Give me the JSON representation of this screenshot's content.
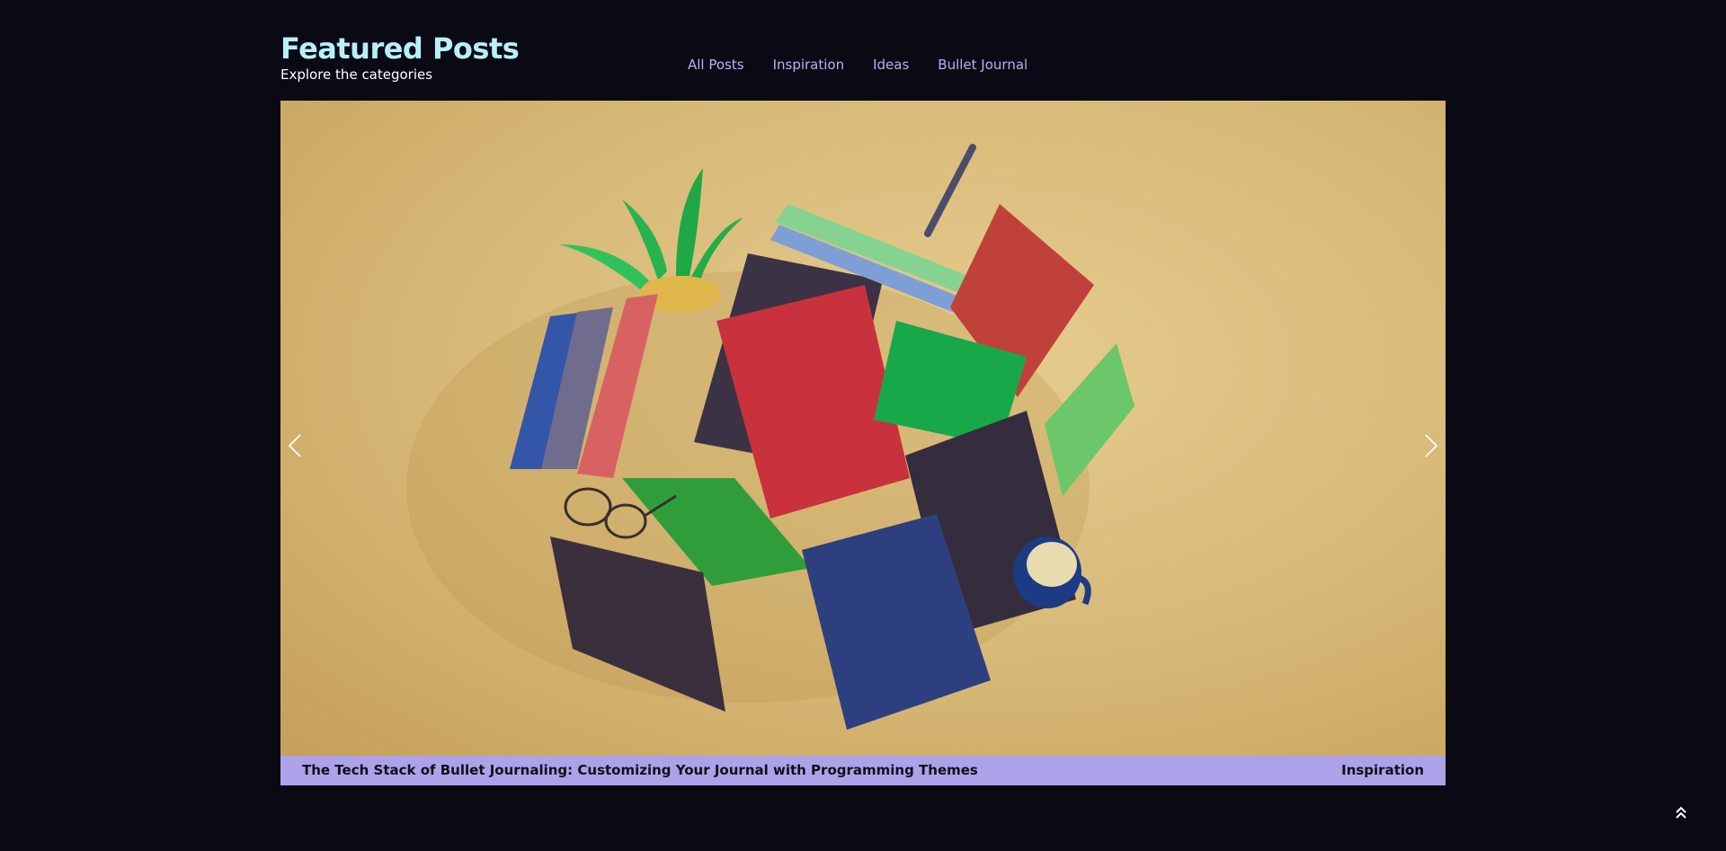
{
  "header": {
    "title": "Featured Posts",
    "subtitle": "Explore the categories",
    "nav": [
      {
        "label": "All Posts"
      },
      {
        "label": "Inspiration"
      },
      {
        "label": "Ideas"
      },
      {
        "label": "Bullet Journal"
      }
    ]
  },
  "slider": {
    "slide": {
      "image_alt": "3D illustration of spiral notebooks, potted plant, glasses, pencil and coffee mug",
      "title": "The Tech Stack of Bullet Journaling: Customizing Your Journal with Programming Themes",
      "category": "Inspiration"
    },
    "prev_icon": "chevron-left-icon",
    "next_icon": "chevron-right-icon"
  },
  "back_to_top_icon": "double-chevron-up-icon",
  "colors": {
    "background": "#0a0a15",
    "title": "#b8f0f8",
    "nav": "#b7b0f2",
    "caption_bar": "#aca2ea",
    "hero_bg": "#dbc184"
  }
}
